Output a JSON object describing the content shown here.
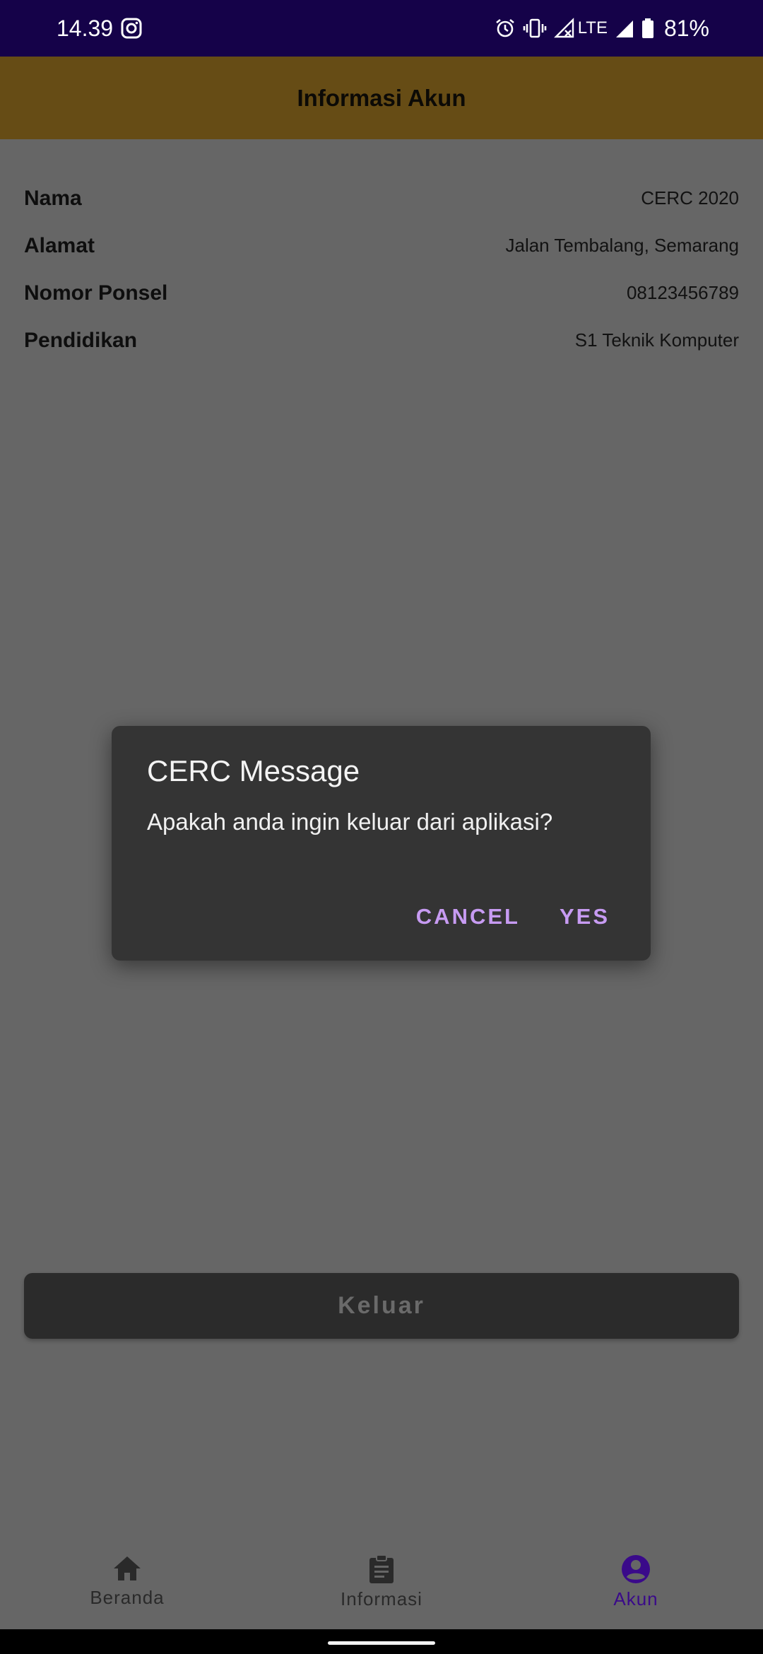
{
  "status_bar": {
    "time": "14.39",
    "network": "LTE",
    "battery": "81%"
  },
  "app_bar": {
    "title": "Informasi Akun"
  },
  "account_info": [
    {
      "label": "Nama",
      "value": "CERC 2020"
    },
    {
      "label": "Alamat",
      "value": "Jalan Tembalang, Semarang"
    },
    {
      "label": "Nomor Ponsel",
      "value": "08123456789"
    },
    {
      "label": "Pendidikan",
      "value": "S1 Teknik Komputer"
    }
  ],
  "logout_button": {
    "label": "Keluar"
  },
  "dialog": {
    "title": "CERC Message",
    "message": "Apakah anda ingin keluar dari aplikasi?",
    "cancel_label": "CANCEL",
    "yes_label": "YES"
  },
  "bottom_nav": {
    "items": [
      {
        "label": "Beranda",
        "icon": "home-icon"
      },
      {
        "label": "Informasi",
        "icon": "clipboard-icon"
      },
      {
        "label": "Akun",
        "icon": "account-circle-icon",
        "active": true
      }
    ]
  },
  "colors": {
    "status_bar": "#150249",
    "app_bar": "#664c15",
    "scrim_background": "#666666",
    "dialog_background": "#343434",
    "dialog_accent": "#c79bf2",
    "active_nav": "#3a0a8a"
  }
}
